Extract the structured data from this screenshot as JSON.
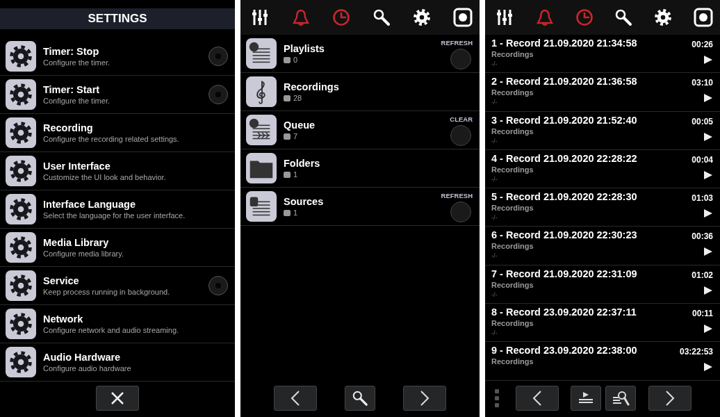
{
  "settings": {
    "title": "SETTINGS",
    "items": [
      {
        "kind": "toggle",
        "title": "Timer: Stop",
        "subtitle": "Configure the timer.",
        "on": false
      },
      {
        "kind": "toggle",
        "title": "Timer: Start",
        "subtitle": "Configure the timer.",
        "on": false
      },
      {
        "kind": "plain",
        "title": "Recording",
        "subtitle": "Configure the recording related settings."
      },
      {
        "kind": "plain",
        "title": "User Interface",
        "subtitle": "Customize the UI look and behavior."
      },
      {
        "kind": "plain",
        "title": "Interface Language",
        "subtitle": "Select the language for the user interface."
      },
      {
        "kind": "plain",
        "title": "Media Library",
        "subtitle": "Configure media library."
      },
      {
        "kind": "toggle",
        "title": "Service",
        "subtitle": "Keep process running in background.",
        "on": false
      },
      {
        "kind": "plain",
        "title": "Network",
        "subtitle": "Configure network and audio streaming."
      },
      {
        "kind": "plain",
        "title": "Audio Hardware",
        "subtitle": "Configure audio hardware"
      }
    ]
  },
  "library": {
    "toolbar": [
      {
        "kind": "sliders",
        "highlighted": false
      },
      {
        "kind": "bell",
        "highlighted": true
      },
      {
        "kind": "timer",
        "highlighted": true
      },
      {
        "kind": "search",
        "highlighted": false
      },
      {
        "kind": "gear",
        "highlighted": false
      },
      {
        "kind": "record",
        "highlighted": false
      }
    ],
    "items": [
      {
        "kind": "playlist",
        "title": "Playlists",
        "count": "0",
        "action": "REFRESH"
      },
      {
        "kind": "recordings",
        "title": "Recordings",
        "count": "28"
      },
      {
        "kind": "queue",
        "title": "Queue",
        "count": "7",
        "action": "CLEAR"
      },
      {
        "kind": "folder",
        "title": "Folders",
        "count": "1"
      },
      {
        "kind": "sources",
        "title": "Sources",
        "count": "1",
        "action": "REFRESH"
      }
    ]
  },
  "recordings": {
    "toolbar": [
      {
        "kind": "sliders",
        "highlighted": false
      },
      {
        "kind": "bell",
        "highlighted": true
      },
      {
        "kind": "timer",
        "highlighted": true
      },
      {
        "kind": "search",
        "highlighted": false
      },
      {
        "kind": "gear",
        "highlighted": false
      },
      {
        "kind": "record",
        "highlighted": false
      }
    ],
    "items": [
      {
        "title": "1 - Record 21.09.2020 21:34:58",
        "duration": "00:26",
        "source": "Recordings",
        "info": "-/-"
      },
      {
        "title": "2 - Record 21.09.2020 21:36:58",
        "duration": "03:10",
        "source": "Recordings",
        "info": "-/-"
      },
      {
        "title": "3 - Record 21.09.2020 21:52:40",
        "duration": "00:05",
        "source": "Recordings",
        "info": "-/-"
      },
      {
        "title": "4 - Record 21.09.2020 22:28:22",
        "duration": "00:04",
        "source": "Recordings",
        "info": "-/-"
      },
      {
        "title": "5 - Record 21.09.2020 22:28:30",
        "duration": "01:03",
        "source": "Recordings",
        "info": "-/-"
      },
      {
        "title": "6 - Record 21.09.2020 22:30:23",
        "duration": "00:36",
        "source": "Recordings",
        "info": "-/-"
      },
      {
        "title": "7 - Record 21.09.2020 22:31:09",
        "duration": "01:02",
        "source": "Recordings",
        "info": "-/-"
      },
      {
        "title": "8 - Record 23.09.2020 22:37:11",
        "duration": "00:11",
        "source": "Recordings",
        "info": "-/-"
      },
      {
        "title": "9 - Record 23.09.2020 22:38:00",
        "duration": "03:22:53",
        "source": "Recordings"
      }
    ]
  }
}
